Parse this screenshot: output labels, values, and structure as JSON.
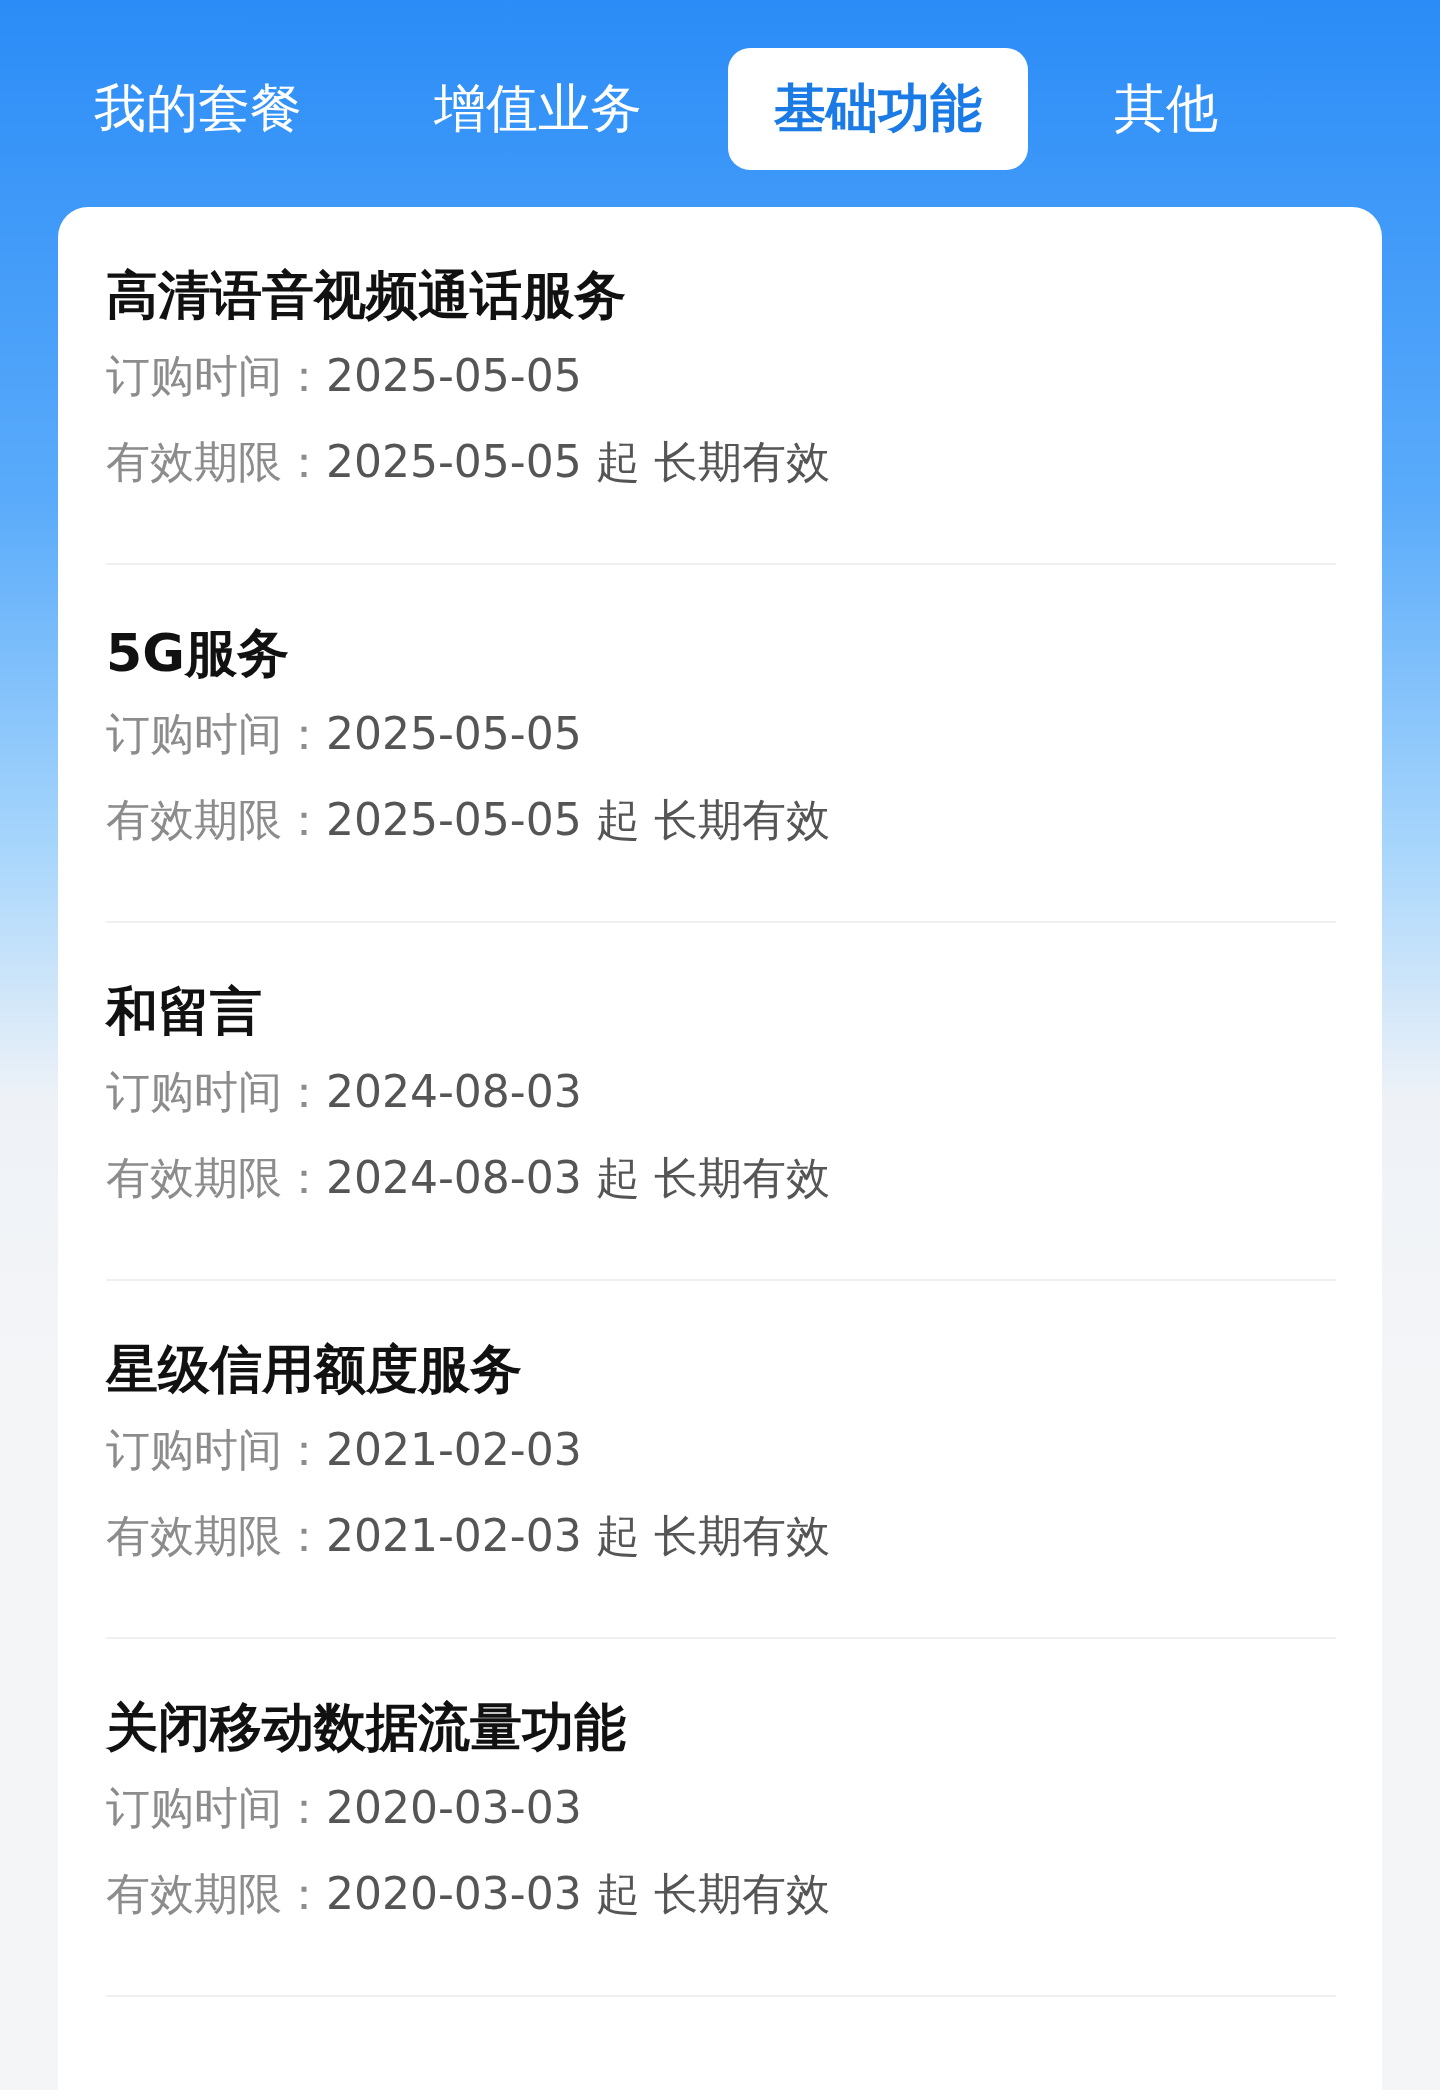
{
  "tabs": [
    {
      "label": "我的套餐",
      "selected": false
    },
    {
      "label": "增值业务",
      "selected": false
    },
    {
      "label": "基础功能",
      "selected": true
    },
    {
      "label": "其他",
      "selected": false
    }
  ],
  "services": [
    {
      "title": "高清语音视频通话服务",
      "order_label": "订购时间：",
      "order_date": "2025-05-05",
      "validity_label": "有效期限：",
      "validity_value": "2025-05-05 起 长期有效"
    },
    {
      "title": "5G服务",
      "order_label": "订购时间：",
      "order_date": "2025-05-05",
      "validity_label": "有效期限：",
      "validity_value": "2025-05-05 起 长期有效"
    },
    {
      "title": "和留言",
      "order_label": "订购时间：",
      "order_date": "2024-08-03",
      "validity_label": "有效期限：",
      "validity_value": "2024-08-03 起 长期有效"
    },
    {
      "title": "星级信用额度服务",
      "order_label": "订购时间：",
      "order_date": "2021-02-03",
      "validity_label": "有效期限：",
      "validity_value": "2021-02-03 起 长期有效"
    },
    {
      "title": "关闭移动数据流量功能",
      "order_label": "订购时间：",
      "order_date": "2020-03-03",
      "validity_label": "有效期限：",
      "validity_value": "2020-03-03 起 长期有效"
    }
  ]
}
